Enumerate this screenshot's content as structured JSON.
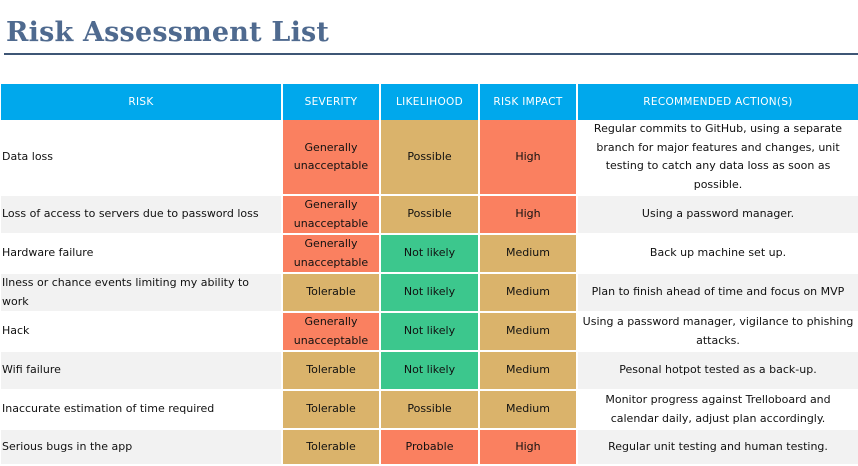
{
  "page": {
    "title": "Risk Assessment List"
  },
  "colors": {
    "header": "#00a8ec",
    "title": "#4f6a8f",
    "red": "#fa8060",
    "amber": "#dab36b",
    "green": "#3cc78d"
  },
  "table": {
    "headers": [
      "RISK",
      "SEVERITY",
      "LIKELIHOOD",
      "RISK IMPACT",
      "RECOMMENDED ACTION(S)"
    ],
    "rows": [
      {
        "risk": "Data loss",
        "severity": "Generally unacceptable",
        "likelihood": "Possible",
        "impact": "High",
        "action": "Regular commits to GitHub, using a separate branch for major features and changes, unit testing to catch any data loss as soon as possible."
      },
      {
        "risk": "Loss of access to servers due to password loss",
        "severity": "Generally unacceptable",
        "likelihood": "Possible",
        "impact": "High",
        "action": "Using a password manager."
      },
      {
        "risk": "Hardware failure",
        "severity": "Generally unacceptable",
        "likelihood": "Not likely",
        "impact": "Medium",
        "action": "Back up machine set up."
      },
      {
        "risk": "Ilness or chance events limiting my ability to work",
        "severity": "Tolerable",
        "likelihood": "Not likely",
        "impact": "Medium",
        "action": "Plan to finish ahead of time and focus on MVP"
      },
      {
        "risk": "Hack",
        "severity": "Generally unacceptable",
        "likelihood": "Not likely",
        "impact": "Medium",
        "action": "Using a password manager, vigilance to phishing attacks."
      },
      {
        "risk": "Wifi failure",
        "severity": "Tolerable",
        "likelihood": "Not likely",
        "impact": "Medium",
        "action": "Pesonal hotpot tested as a back-up."
      },
      {
        "risk": "Inaccurate estimation of time required",
        "severity": "Tolerable",
        "likelihood": "Possible",
        "impact": "Medium",
        "action": "Monitor progress against Trelloboard and calendar daily, adjust plan accordingly."
      },
      {
        "risk": "Serious bugs in the app",
        "severity": "Tolerable",
        "likelihood": "Probable",
        "impact": "High",
        "action": "Regular unit testing and human testing."
      }
    ]
  }
}
